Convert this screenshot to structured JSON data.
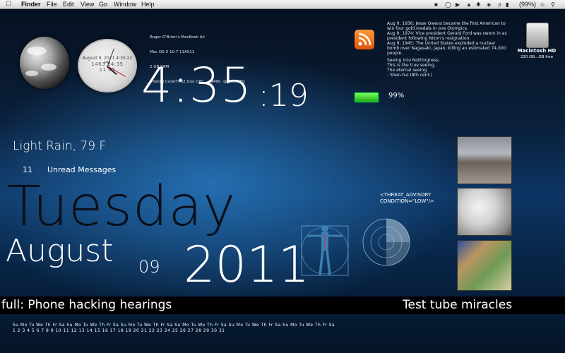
{
  "menubar": {
    "apple": "",
    "app": "Finder",
    "menus": [
      "File",
      "Edit",
      "View",
      "Go",
      "Window",
      "Help"
    ],
    "battery": "(99%)",
    "time": "Tue 4:35 PM"
  },
  "system_info": {
    "lines": [
      "Roger O'Brien's MacBook Air",
      "Mac OS X 10.7 11A511",
      "2 GB RAM",
      "Intel(R) Core(TM)2 Duo CPU    L9400  @ 1.86GHz"
    ]
  },
  "analog_clock": {
    "date": "August 9, 2011 4:35:22 PM",
    "digits": "1463 14:35 11:02"
  },
  "clock": {
    "hours_minutes": "4:35",
    "seconds": ":19"
  },
  "history": {
    "text": "Aug 9, 1936: Jesse Owens became the first American to win four gold medals in one Olympics.\nAug 9, 1974: Vice president Gerald Ford was sworn in as president following Nixon's resignation.\nAug 9, 1945: The United States exploded a nuclear bomb over Nagasaki, Japan, killing an estimated 74,000 people."
  },
  "poem": {
    "text": "Seeing into Nothingness\nThis is the true seeing,\nThe eternal seeing.\n- Shen-hui (8th cent.)"
  },
  "battery": {
    "percent": "99%",
    "level": 0.99,
    "color": "#3cdc2a"
  },
  "drive": {
    "name": "Macintosh HD",
    "size": "220 GB...GB free"
  },
  "weather": {
    "text": "Light Rain, 79 F"
  },
  "messages": {
    "count": "11",
    "label": "Unread Messages"
  },
  "date": {
    "weekday": "Tuesday",
    "month": "August",
    "day": "09",
    "year": "2011"
  },
  "threat": {
    "text": "<THREAT_ADVISORY\nCONDITION=\"LOW\"/>"
  },
  "ticker": {
    "left": "full: Phone hacking hearings",
    "right": "Test tube miracles"
  },
  "calendar": {
    "day_headers": "Su Mo Tu We Th Fr Sa Su Mo Tu We Th Fr Sa Su Mo Tu We Th Fr Sa Su Mo Tu We Th Fr Sa Su Mo Tu We Th Fr Sa Su Mo Tu We Th Fr Sa",
    "numbers": "1  2  3  4  5  6  7  8  9 10 11 12 13 14 15 16 17 18 19 20 21 22 23 24 25 26 27 28 29 30 31"
  },
  "icons": {
    "rss": "rss-icon",
    "drive": "hard-drive-icon",
    "battery": "battery-icon",
    "wifi": "wifi-icon",
    "bluetooth": "bluetooth-icon",
    "volume": "volume-icon",
    "search": "spotlight-icon"
  }
}
